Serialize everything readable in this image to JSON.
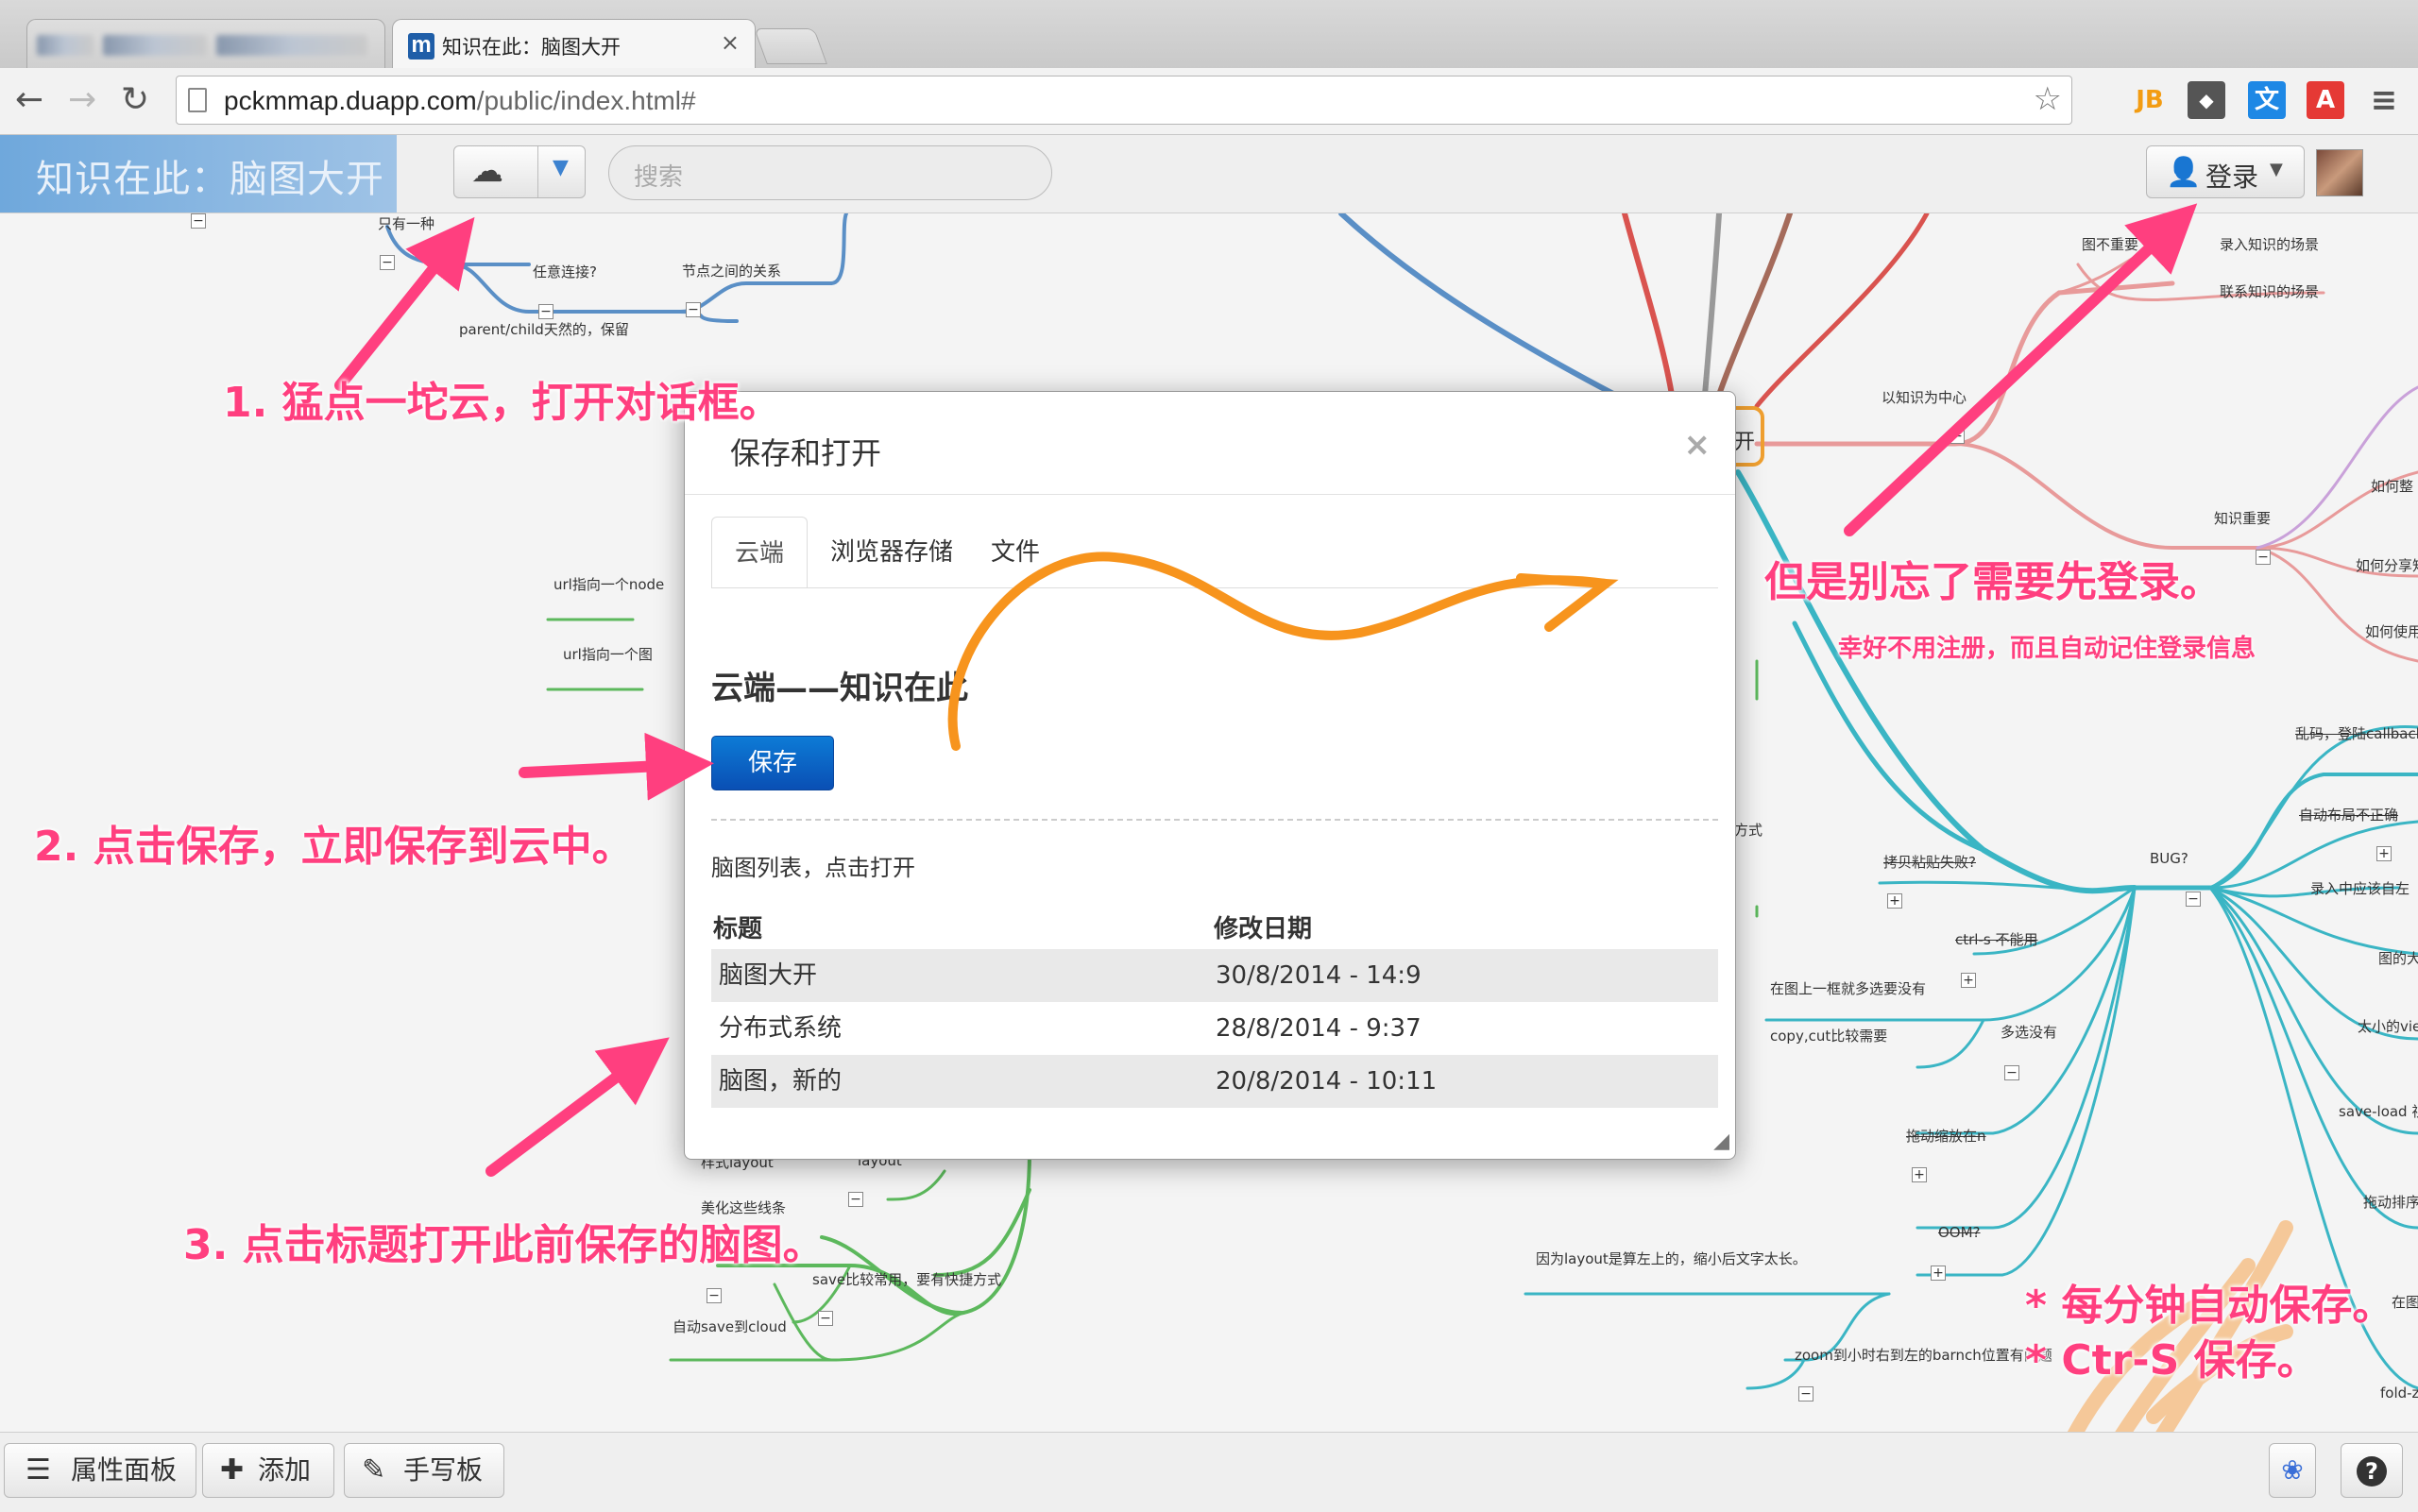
{
  "browser": {
    "active_tab_favicon": "m",
    "active_tab_title": "知识在此：脑图大开",
    "close_glyph": "×",
    "url_host": "pckmmap.duapp.com",
    "url_path": "/public/index.html#"
  },
  "extensions": [
    {
      "icon": "jetbrains-icon",
      "glyph": "JB",
      "color": "#f39c12"
    },
    {
      "icon": "pocket-icon",
      "glyph": "◆",
      "color": "#555555"
    },
    {
      "icon": "translate-icon",
      "glyph": "文",
      "color": "#1e88e5"
    },
    {
      "icon": "pdf-icon",
      "glyph": "A",
      "color": "#e53935"
    }
  ],
  "app": {
    "brand": "知识在此：脑图大开",
    "search_placeholder": "搜索",
    "login_label": "登录"
  },
  "modal": {
    "title": "保存和打开",
    "tabs": [
      "云端",
      "浏览器存储",
      "文件"
    ],
    "heading": "云端——知识在此",
    "save_label": "保存",
    "list_caption": "脑图列表，点击打开",
    "columns": [
      "标题",
      "修改日期"
    ],
    "rows": [
      {
        "title": "脑图大开",
        "date": "30/8/2014 - 14:9"
      },
      {
        "title": "分布式系统",
        "date": "28/8/2014 - 9:37"
      },
      {
        "title": "脑图，新的",
        "date": "20/8/2014 - 10:11"
      }
    ]
  },
  "annotations": {
    "step1": "1. 猛点一坨云，打开对话框。",
    "step2": "2. 点击保存，立即保存到云中。",
    "step3": "3. 点击标题打开此前保存的脑图。",
    "login_note": "但是别忘了需要先登录。",
    "login_subnote": "幸好不用注册，而且自动记住登录信息",
    "autosave1": "* 每分钟自动保存。",
    "autosave2": "* Ctr-S 保存。"
  },
  "mindmap": {
    "labels": [
      "只有一种",
      "任意连接?",
      "节点之间的关系",
      "parent/child天然的，保留",
      "url指向一个node",
      "url指向一个图",
      "图不重要",
      "录入知识的场景",
      "联系知识的场景",
      "以知识为中心",
      "知识重要",
      "如何整",
      "如何分享知",
      "如何使用",
      "乱码，登陆callback",
      "自动布局不正确",
      "录入中应该自左",
      "拷贝粘贴失败?",
      "BUG?",
      "ctrl-s 不能用",
      "图的大",
      "在图上一框就多选要没有",
      "copy,cut比较需要",
      "多选没有",
      "太小的vie",
      "拖动缩放在n",
      "save-load 视觉反馈",
      "拖动排序",
      "OOM?",
      "因为layout是算左上的，缩小后文字太长。",
      "fold-zo",
      "zoom到小时右到左的barnch位置有问题",
      "在图",
      "样式layout",
      "layout",
      "美化这些线条",
      "save比较常用，要有快捷方式",
      "自动save到cloud",
      "方式",
      "开"
    ]
  },
  "bottom_bar": {
    "panel_label": "属性面板",
    "add_label": "添加",
    "handwrite_label": "手写板",
    "help_glyph": "?"
  }
}
